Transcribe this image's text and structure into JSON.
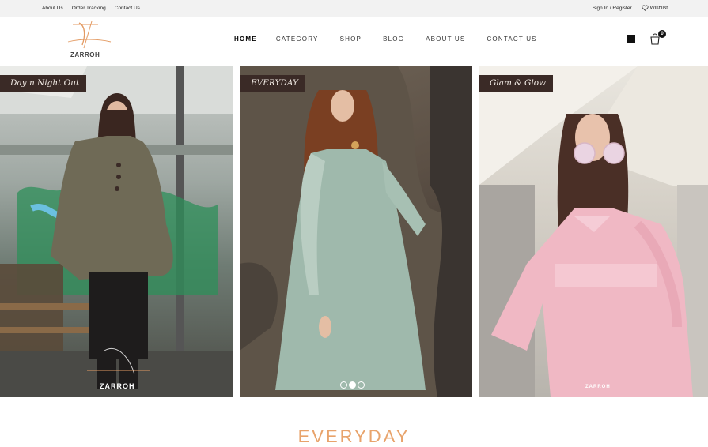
{
  "topbar": {
    "links": [
      "About Us",
      "Order Tracking",
      "Contact Us"
    ],
    "signin": "Sign In / Register",
    "wishlist": "Wishlist"
  },
  "header": {
    "logo_text": "ZARROH",
    "nav": [
      "HOME",
      "CATEGORY",
      "SHOP",
      "BLOG",
      "ABOUT US",
      "CONTACT US"
    ],
    "active": "HOME",
    "cart_count": "0"
  },
  "panels": [
    {
      "tag": "Day n Night Out",
      "watermark": "ZARROH"
    },
    {
      "tag": "EVERYDAY"
    },
    {
      "tag": "Glam & Glow",
      "watermark": "ZARROH"
    }
  ],
  "slider": {
    "dots": 3,
    "active_dot": 1
  },
  "section": {
    "title": "EVERYDAY"
  },
  "colors": {
    "accent": "#e8a36b",
    "tag_bg": "#3a2a26",
    "topbar_bg": "#f2f2f2"
  }
}
